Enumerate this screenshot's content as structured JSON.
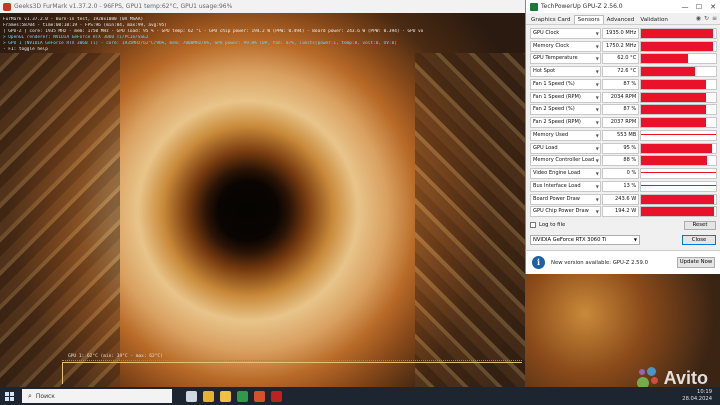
{
  "furmark": {
    "title": "Geeks3D FurMark v1.37.2.0 - 96FPS, GPU1 temp:62°C, GPU1 usage:96%",
    "overlay": [
      {
        "text": "FurMark v1.37.2.0 - Burn-in test, 1920x1080 (0X MSAA)",
        "tone": "w"
      },
      {
        "text": "Frames:58704 - time:00:10:19 - FPS:96 (min:84, max:99, avg:95)",
        "tone": "w"
      },
      {
        "text": "[ GPU-Z ] core: 1935 MHz - mem: 1750 MHz - GPU load: 95 % - GPU temp: 62 °C - GPU chip power: 194.2 W (PPW: 0.494) - Board power: 243.6 W (PPW: 0.394) - GPU voltage: 1.018 V",
        "tone": "w"
      },
      {
        "text": "> OpenGL renderer: NVIDIA GeForce RTX 3060 Ti/PCIe/SSE2",
        "tone": "c"
      },
      {
        "text": "> GPU 1 (NVIDIA GeForce RTX 3060 Ti) - core: 1935MHz/62°C/96%, mem: 7000MHz/6%, GPU power: 99.8% TDP, fan: 87%, limits[power:1, temp:0, volt:0, OV:0]",
        "tone": "c"
      },
      {
        "text": "- F1: toggle help",
        "tone": "w"
      }
    ],
    "graph_label": "GPU 1: 62°C (min: 39°C - max: 62°C)"
  },
  "gpuz": {
    "title": "TechPowerUp GPU-Z 2.56.0",
    "window_controls": {
      "minimize": "—",
      "maximize": "☐",
      "close": "✕"
    },
    "tabs": [
      {
        "label": "Graphics Card",
        "active": false
      },
      {
        "label": "Sensors",
        "active": true
      },
      {
        "label": "Advanced",
        "active": false
      },
      {
        "label": "Validation",
        "active": false
      }
    ],
    "tool_icons": [
      "camera-icon",
      "refresh-icon",
      "menu-icon"
    ],
    "sensors": [
      {
        "name": "GPU Clock",
        "value": "1935.0 MHz",
        "level": 0.96
      },
      {
        "name": "Memory Clock",
        "value": "1750.2 MHz",
        "level": 0.96
      },
      {
        "name": "GPU Temperature",
        "value": "62.0 °C",
        "level": 0.62
      },
      {
        "name": "Hot Spot",
        "value": "72.6 °C",
        "level": 0.72
      },
      {
        "name": "Fan 1 Speed (%)",
        "value": "87 %",
        "level": 0.87
      },
      {
        "name": "Fan 1 Speed (RPM)",
        "value": "2034 RPM",
        "level": 0.87
      },
      {
        "name": "Fan 2 Speed (%)",
        "value": "87 %",
        "level": 0.87
      },
      {
        "name": "Fan 2 Speed (RPM)",
        "value": "2037 RPM",
        "level": 0.87
      },
      {
        "name": "Memory Used",
        "value": "553 MB",
        "level": 0.12
      },
      {
        "name": "GPU Load",
        "value": "95 %",
        "level": 0.95
      },
      {
        "name": "Memory Controller Load",
        "value": "88 %",
        "level": 0.88
      },
      {
        "name": "Video Engine Load",
        "value": "0 %",
        "level": 0.0
      },
      {
        "name": "Bus Interface Load",
        "value": "13 %",
        "level": 0.13
      },
      {
        "name": "Board Power Draw",
        "value": "243.6 W",
        "level": 0.97
      },
      {
        "name": "GPU Chip Power Draw",
        "value": "194.2 W",
        "level": 0.97
      }
    ],
    "log_label": "Log to file",
    "reset_label": "Reset",
    "gpu_selected": "NVIDIA GeForce RTX 3060 Ti",
    "close_label": "Close"
  },
  "update": {
    "message": "New version available: GPU-Z 2.59.0",
    "button": "Update Now"
  },
  "taskbar": {
    "search_placeholder": "Поиск",
    "time": "10:19",
    "date": "28.04.2024",
    "app_icons": [
      {
        "name": "task-view-icon",
        "color": "#cfd8e3"
      },
      {
        "name": "chrome-icon",
        "color": "#e8b230"
      },
      {
        "name": "file-explorer-icon",
        "color": "#f0c040"
      },
      {
        "name": "gpuz-taskbar-icon",
        "color": "#2e9a4a"
      },
      {
        "name": "furmark-taskbar-icon",
        "color": "#d8502a"
      },
      {
        "name": "recorder-icon",
        "color": "#c02020"
      }
    ]
  },
  "watermark": "Avito"
}
